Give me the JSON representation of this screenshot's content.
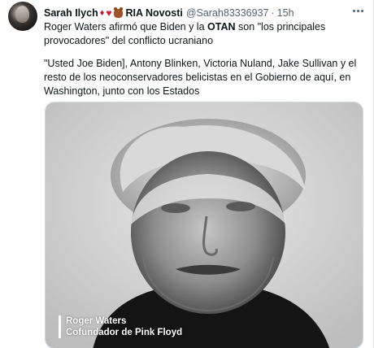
{
  "tweet": {
    "display_name": "Sarah Ilych",
    "org_name": "RIA Novosti",
    "handle": "@Sarah83336937",
    "separator": "·",
    "time": "15h",
    "text_p1_before": "Roger Waters afirmó que Biden y la ",
    "text_p1_bold": "OTAN",
    "text_p1_after": " son \"los principales provocadores\" del conflicto ucraniano",
    "text_p2": "\"Usted Joe Biden], Antony Blinken, Victoria Nuland, Jake Sullivan y el resto de los neoconservadores belicistas en el Gobierno de aquí, en Washington, junto con los Estados",
    "emojis": [
      "diamond-suit-icon",
      "red-heart-icon",
      "teddy-bear-icon"
    ],
    "media": {
      "caption_name": "Roger Waters",
      "caption_title": "Cofundador de Pink Floyd"
    }
  },
  "colors": {
    "text": "#0f1419",
    "muted": "#536471",
    "emoji_red": "#c8102e",
    "border": "#cfd9de"
  }
}
